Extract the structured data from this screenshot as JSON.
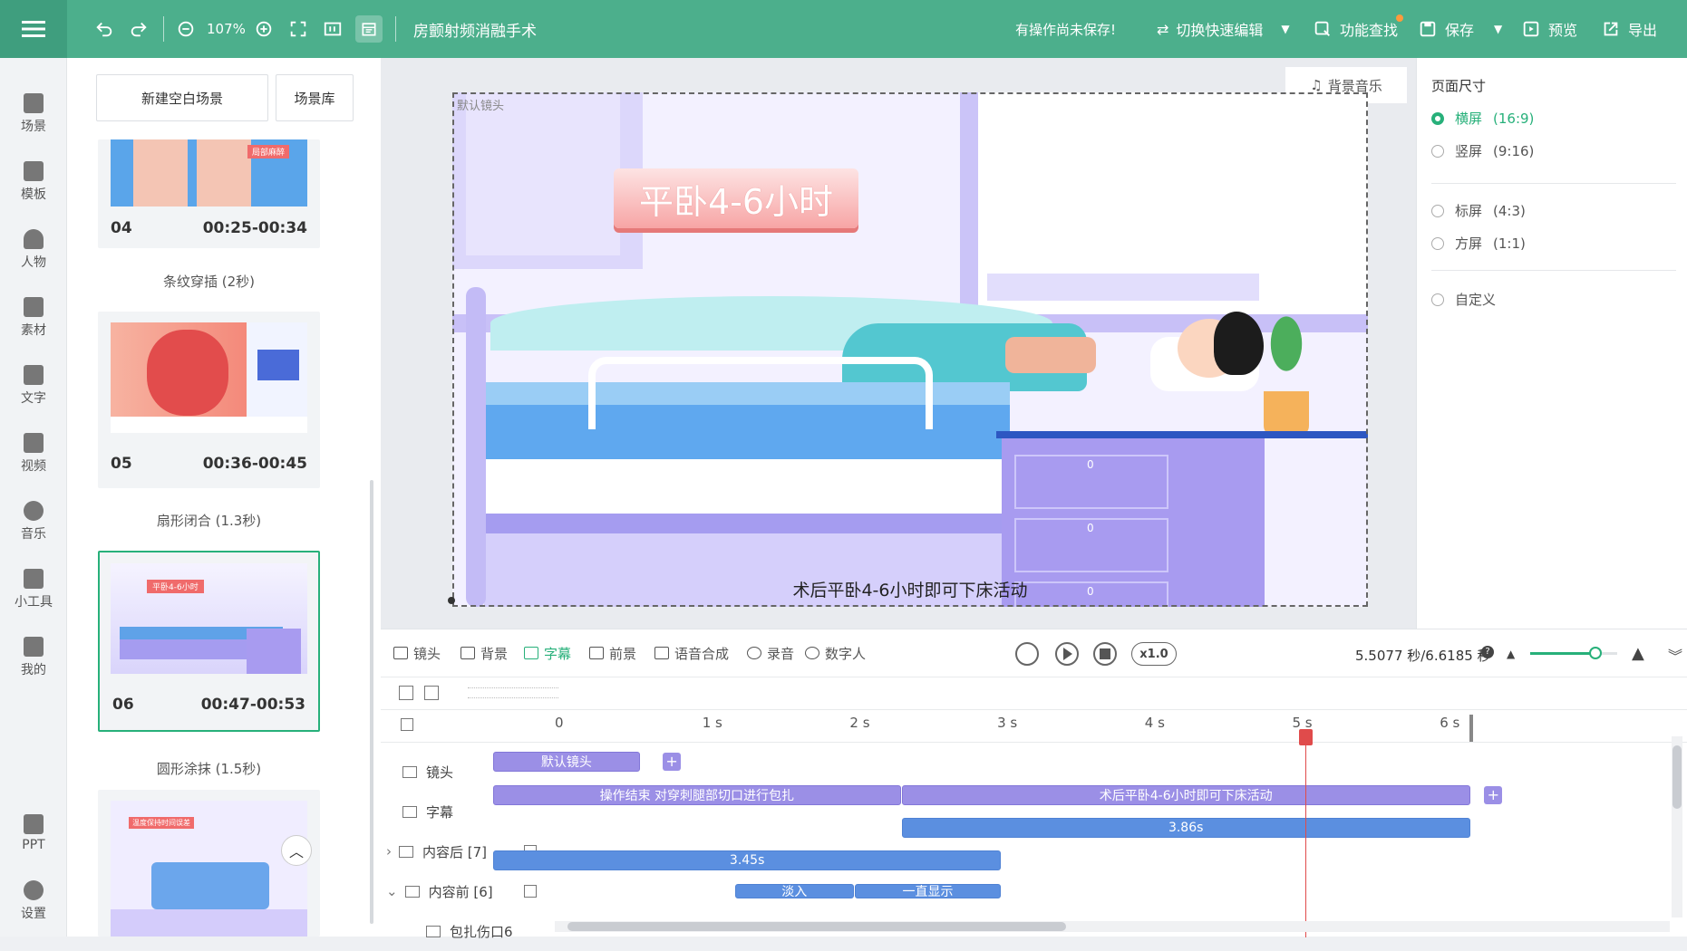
{
  "topbar": {
    "zoom": "107%",
    "title": "房颤射频消融手术",
    "unsaved": "有操作尚未保存!",
    "quick_edit": "切换快速编辑",
    "feature_search": "功能查找",
    "save": "保存",
    "preview": "预览",
    "export": "导出"
  },
  "nav": [
    {
      "label": "场景",
      "icon": "scene-icon"
    },
    {
      "label": "模板",
      "icon": "template-icon"
    },
    {
      "label": "人物",
      "icon": "person-icon"
    },
    {
      "label": "素材",
      "icon": "assets-icon"
    },
    {
      "label": "文字",
      "icon": "text-icon"
    },
    {
      "label": "视频",
      "icon": "video-icon"
    },
    {
      "label": "音乐",
      "icon": "music-icon"
    },
    {
      "label": "小工具",
      "icon": "toolbox-icon"
    },
    {
      "label": "我的",
      "icon": "upload-icon"
    },
    {
      "label": "PPT",
      "icon": "ppt-icon"
    },
    {
      "label": "设置",
      "icon": "gear-icon"
    }
  ],
  "scenes": {
    "new_blank": "新建空白场景",
    "library": "场景库",
    "items": [
      {
        "num": "04",
        "range": "00:25-00:34",
        "label": "条纹穿插 (2秒)",
        "badge": "局部麻醉"
      },
      {
        "num": "05",
        "range": "00:36-00:45",
        "label": "扇形闭合 (1.3秒)"
      },
      {
        "num": "06",
        "range": "00:47-00:53",
        "label": "圆形涂抹 (1.5秒)",
        "badge": "平卧4-6小时"
      },
      {
        "badge": "温度保持时间误差"
      }
    ]
  },
  "canvas": {
    "camera_label": "默认镜头",
    "bg_music": "背景音乐",
    "banner": "平卧4-6小时",
    "subtitle": "术后平卧4-6小时即可下床活动",
    "drawer_marks": [
      "0",
      "0",
      "0"
    ]
  },
  "page_size": {
    "title": "页面尺寸",
    "options": [
      {
        "label": "横屏",
        "ratio": "(16:9)",
        "selected": true
      },
      {
        "label": "竖屏",
        "ratio": "(9:16)",
        "selected": false
      },
      {
        "label": "标屏",
        "ratio": "(4:3)",
        "selected": false
      },
      {
        "label": "方屏",
        "ratio": "(1:1)",
        "selected": false
      },
      {
        "label": "自定义",
        "ratio": "",
        "selected": false
      }
    ]
  },
  "timeline": {
    "tabs": [
      "镜头",
      "背景",
      "字幕",
      "前景",
      "语音合成",
      "录音",
      "数字人"
    ],
    "active_tab": "字幕",
    "speed": "x1.0",
    "time": "5.5077 秒/6.6185 秒",
    "zoom_level": 0.75,
    "ticks": [
      "0",
      "1 s",
      "2 s",
      "3 s",
      "4 s",
      "5 s",
      "6 s"
    ],
    "rows": [
      {
        "label": "镜头"
      },
      {
        "label": "字幕"
      },
      {
        "label": "内容后 [7]"
      },
      {
        "label": "内容前 [6]"
      },
      {
        "label": "包扎伤口6"
      }
    ],
    "clips": {
      "camera": "默认镜头",
      "sub1": "操作结束 对穿刺腿部切口进行包扎",
      "sub2": "术后平卧4-6小时即可下床活动",
      "after": "3.86s",
      "before": "3.45s",
      "fadein": "淡入",
      "always": "一直显示"
    },
    "playhead_s": 5.5077,
    "total_s": 6.6185
  }
}
